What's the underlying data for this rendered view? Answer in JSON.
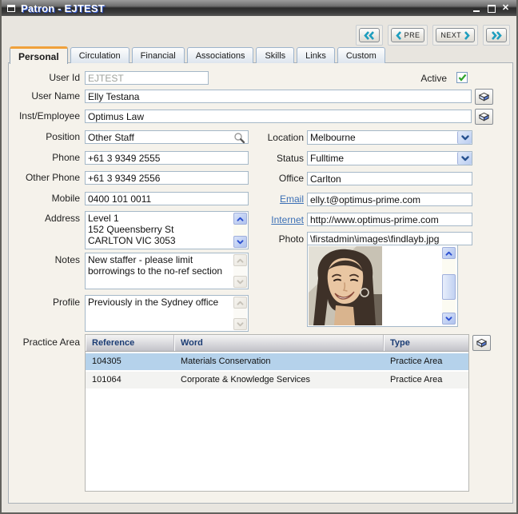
{
  "window": {
    "title": "Patron - EJTEST",
    "controls": {
      "close_glyph": "✕"
    }
  },
  "nav": {
    "prev_label": "PRE",
    "next_label": "NEXT"
  },
  "tabs": [
    {
      "label": "Personal",
      "active": true
    },
    {
      "label": "Circulation",
      "active": false
    },
    {
      "label": "Financial",
      "active": false
    },
    {
      "label": "Associations",
      "active": false
    },
    {
      "label": "Skills",
      "active": false
    },
    {
      "label": "Links",
      "active": false
    },
    {
      "label": "Custom",
      "active": false
    }
  ],
  "fields": {
    "user_id": {
      "label": "User Id",
      "value": "EJTEST",
      "readonly": true
    },
    "active": {
      "label": "Active",
      "checked": true
    },
    "user_name": {
      "label": "User Name",
      "value": "Elly Testana"
    },
    "inst_employee": {
      "label": "Inst/Employee",
      "value": "Optimus Law"
    },
    "position": {
      "label": "Position",
      "value": "Other Staff"
    },
    "location": {
      "label": "Location",
      "value": "Melbourne"
    },
    "phone": {
      "label": "Phone",
      "value": "+61 3 9349 2555"
    },
    "status": {
      "label": "Status",
      "value": "Fulltime"
    },
    "other_phone": {
      "label": "Other Phone",
      "value": "+61 3 9349 2556"
    },
    "office": {
      "label": "Office",
      "value": "Carlton"
    },
    "mobile": {
      "label": "Mobile",
      "value": "0400 101 0011"
    },
    "email": {
      "label": "Email",
      "value": "elly.t@optimus-prime.com"
    },
    "address": {
      "label": "Address",
      "value": "Level 1\n152 Queensberry St\nCARLTON VIC 3053"
    },
    "internet": {
      "label": "Internet",
      "value": "http://www.optimus-prime.com"
    },
    "photo": {
      "label": "Photo",
      "value": "\\firstadmin\\images\\findlayb.jpg"
    },
    "notes": {
      "label": "Notes",
      "value": "New staffer - please limit borrowings to the no-ref section"
    },
    "profile": {
      "label": "Profile",
      "value": "Previously in the Sydney office"
    }
  },
  "practice_area": {
    "label": "Practice Area",
    "columns": {
      "reference": "Reference",
      "word": "Word",
      "type": "Type"
    },
    "rows": [
      {
        "reference": "104305",
        "word": "Materials Conservation",
        "type": "Practice Area",
        "selected": true
      },
      {
        "reference": "101064",
        "word": "Corporate & Knowledge Services",
        "type": "Practice Area",
        "selected": false
      }
    ]
  },
  "colors": {
    "accent_orange": "#F0A13C",
    "link_blue": "#3B6FB5",
    "selected_row_blue": "#B5D2EB",
    "header_text_navy": "#1B3C74",
    "check_green": "#2FA42B",
    "nav_chevron_teal": "#1E9EBE"
  }
}
